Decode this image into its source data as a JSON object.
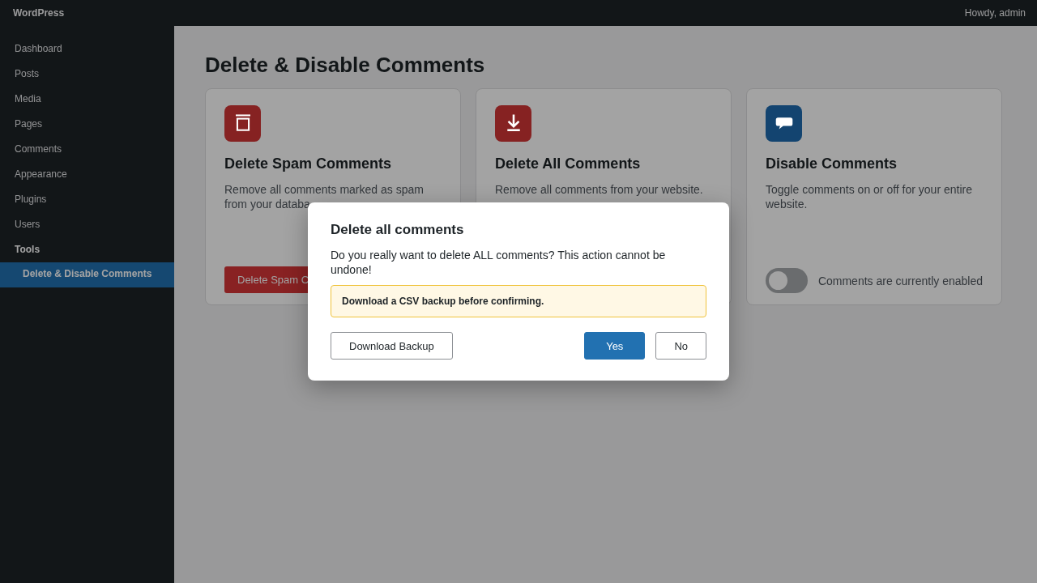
{
  "top_bar": {
    "site": "WordPress",
    "greeting": "Howdy, admin"
  },
  "sidebar": {
    "items": [
      {
        "label": "Dashboard",
        "expanded": false
      },
      {
        "label": "Posts",
        "expanded": false
      },
      {
        "label": "Media",
        "expanded": false
      },
      {
        "label": "Pages",
        "expanded": false
      },
      {
        "label": "Comments",
        "expanded": false
      },
      {
        "label": "Appearance",
        "expanded": false
      },
      {
        "label": "Plugins",
        "expanded": false
      },
      {
        "label": "Users",
        "expanded": false
      },
      {
        "label": "Tools",
        "expanded": true,
        "children": [
          {
            "label": "Delete & Disable Comments",
            "selected": true
          }
        ]
      }
    ]
  },
  "page": {
    "title": "Delete & Disable Comments"
  },
  "cards": [
    {
      "title": "Delete Spam Comments",
      "description": [
        "Remove all comments marked as spam",
        "from your databa"
      ],
      "color": "#862222",
      "footer": {
        "kind": "button",
        "label": "Delete Spam C"
      }
    },
    {
      "title": "Delete All Comments",
      "description": [
        "Remove all comments from your website."
      ],
      "color": "#862222"
    },
    {
      "title": "Disable Comments",
      "description": [
        "Toggle comments on or off for your entire",
        "website."
      ],
      "color": "#134470",
      "footer": {
        "kind": "toggle",
        "on": false,
        "label": "Comments are currently enabled"
      }
    }
  ],
  "modal": {
    "title": "Delete all comments",
    "message": "Do you really want to delete ALL comments? This action cannot be undone!",
    "notice": "Download a CSV backup before confirming.",
    "buttons": [
      {
        "label": "Download Backup",
        "kind": "secondary"
      },
      {
        "label": "Yes",
        "kind": "primary"
      },
      {
        "label": "No",
        "kind": "secondary"
      }
    ]
  }
}
